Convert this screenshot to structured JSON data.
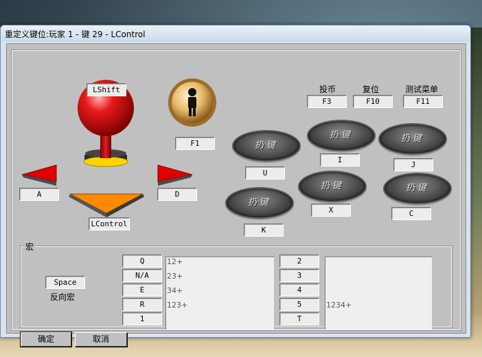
{
  "window": {
    "title": "重定义键位:玩家 1 - 键 29 - LControl"
  },
  "joystick": {
    "up": "LShift",
    "down": "LControl",
    "left": "A",
    "right": "D",
    "center": "F1"
  },
  "system_keys": [
    {
      "label": "投币",
      "key": "F3"
    },
    {
      "label": "复位",
      "key": "F10"
    },
    {
      "label": "测试菜单",
      "key": "F11"
    }
  ],
  "action_button_text": "扔键",
  "action_buttons": {
    "btn1": "U",
    "btn2": "I",
    "btn3": "J",
    "btn4": "K",
    "btn5": "X",
    "btn6": "C"
  },
  "macro": {
    "group_label": "宏",
    "trigger_key": "Space",
    "reverse_label": "反向宏",
    "left_keys": [
      "Q",
      "N/A",
      "E",
      "R",
      "1"
    ],
    "left_lines": [
      "12+",
      "23+",
      "34+",
      "123+"
    ],
    "right_keys": [
      "2",
      "3",
      "4",
      "5",
      "T"
    ],
    "right_lines": [
      "",
      "",
      "",
      "1234+"
    ]
  },
  "buttons": {
    "ok": "确定",
    "cancel": "取消"
  },
  "colors": {
    "dialog_gray": "#c0c0c0",
    "joystick_red": "#d40c0c",
    "arrow_orange": "#ff8a00"
  }
}
